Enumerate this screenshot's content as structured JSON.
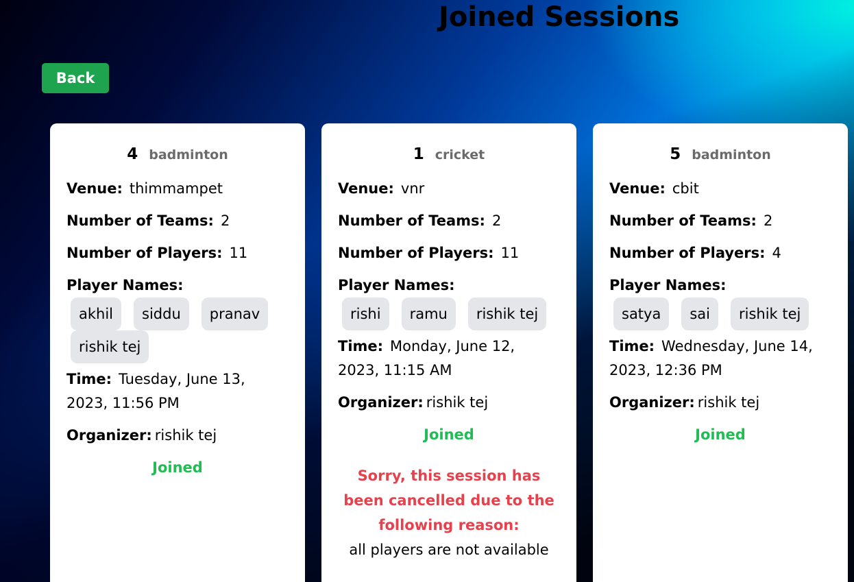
{
  "page": {
    "title": "Joined Sessions",
    "back_label": "Back"
  },
  "labels": {
    "venue": "Venue:",
    "teams": "Number of Teams:",
    "players": "Number of Players:",
    "player_names": "Player Names:",
    "time": "Time:",
    "organizer": "Organizer:"
  },
  "sessions": [
    {
      "id": "4",
      "sport": "badminton",
      "venue": "thimmampet",
      "teams": "2",
      "players": "11",
      "player_names": [
        "akhil",
        "siddu",
        "pranav",
        "rishik tej"
      ],
      "time": "Tuesday, June 13, 2023, 11:56 PM",
      "organizer": "rishik tej",
      "status": "Joined"
    },
    {
      "id": "1",
      "sport": "cricket",
      "venue": "vnr",
      "teams": "2",
      "players": "11",
      "player_names": [
        "rishi",
        "ramu",
        "rishik tej"
      ],
      "time": "Monday, June 12, 2023, 11:15 AM",
      "organizer": "rishik tej",
      "status": "Joined",
      "cancel_message": "Sorry, this session has been cancelled due to the following reason:",
      "cancel_reason": "all players are not available"
    },
    {
      "id": "5",
      "sport": "badminton",
      "venue": "cbit",
      "teams": "2",
      "players": "4",
      "player_names": [
        "satya",
        "sai",
        "rishik tej"
      ],
      "time": "Wednesday, June 14, 2023, 12:36 PM",
      "organizer": "rishik tej",
      "status": "Joined"
    }
  ],
  "colors": {
    "back_button": "#1ea44e",
    "joined": "#22bb55",
    "cancelled": "#e5424d",
    "chip": "#e4e6ea",
    "sport_label": "#6b6b6b"
  }
}
